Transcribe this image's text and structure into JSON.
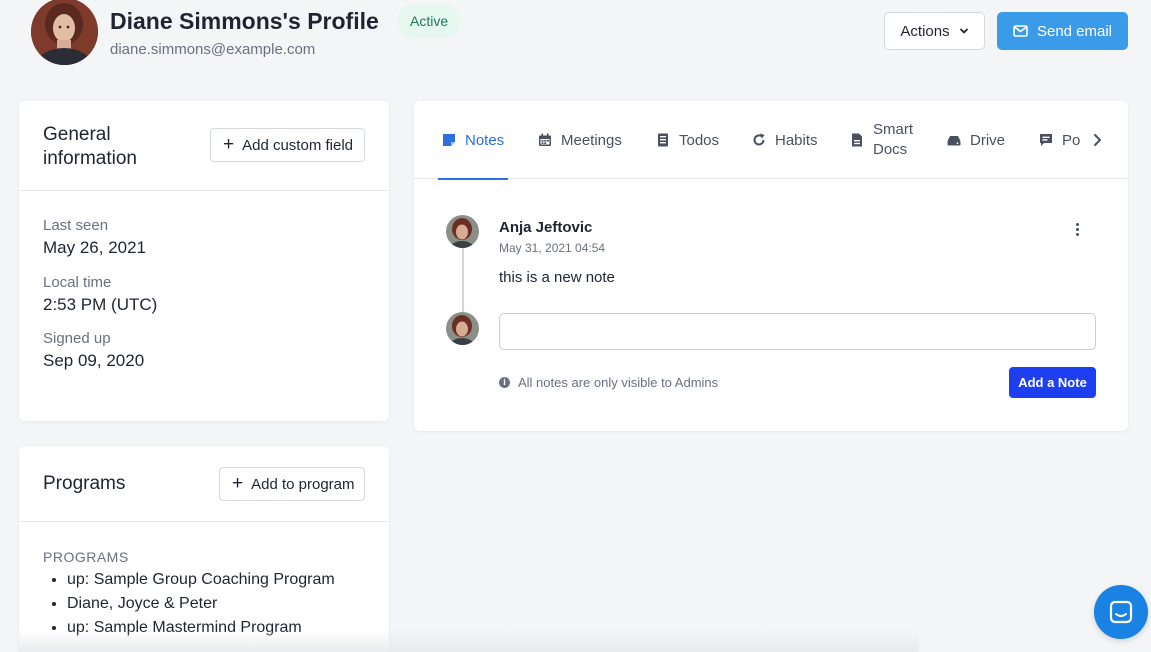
{
  "header": {
    "title": "Diane Simmons's Profile",
    "status": "Active",
    "email": "diane.simmons@example.com",
    "actions_label": "Actions",
    "send_email_label": "Send email"
  },
  "general_info": {
    "title": "General information",
    "add_field_label": "Add custom field",
    "fields": [
      {
        "label": "Last seen",
        "value": "May 26, 2021"
      },
      {
        "label": "Local time",
        "value": "2:53 PM (UTC)"
      },
      {
        "label": "Signed up",
        "value": "Sep 09, 2020"
      }
    ]
  },
  "programs": {
    "title": "Programs",
    "add_label": "Add to program",
    "heading": "PROGRAMS",
    "items": [
      "up: Sample Group Coaching Program",
      "Diane, Joyce & Peter",
      "up: Sample Mastermind Program"
    ]
  },
  "tabs": [
    {
      "label": "Notes",
      "icon": "note-icon",
      "active": true
    },
    {
      "label": "Meetings",
      "icon": "calendar-icon",
      "active": false
    },
    {
      "label": "Todos",
      "icon": "list-icon",
      "active": false
    },
    {
      "label": "Habits",
      "icon": "refresh-icon",
      "active": false
    },
    {
      "label": "Smart Docs",
      "icon": "document-icon",
      "active": false
    },
    {
      "label": "Drive",
      "icon": "drive-icon",
      "active": false
    },
    {
      "label": "Po",
      "icon": "comment-icon",
      "active": false
    }
  ],
  "note": {
    "author": "Anja Jeftovic",
    "timestamp": "May 31, 2021 04:54",
    "body": "this is a new note"
  },
  "composer": {
    "input_value": "",
    "visibility_text": "All notes are only visible to Admins",
    "add_label": "Add a Note"
  },
  "colors": {
    "accent": "#2d6fe0",
    "send_email": "#3b9be8",
    "add_note": "#1e3ff0",
    "active_badge_bg": "#e6f7ef",
    "active_badge_text": "#1d7a52",
    "chat_fab": "#1a82e2"
  }
}
